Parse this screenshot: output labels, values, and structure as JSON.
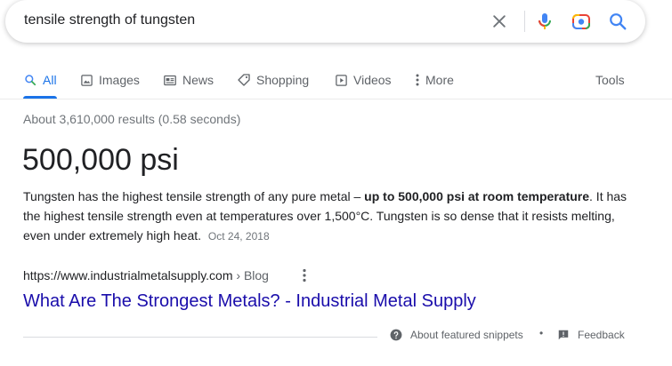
{
  "search": {
    "query": "tensile strength of tungsten"
  },
  "tabs": [
    {
      "label": "All",
      "icon": "search-icon",
      "active": true
    },
    {
      "label": "Images",
      "icon": "image-icon"
    },
    {
      "label": "News",
      "icon": "news-icon"
    },
    {
      "label": "Shopping",
      "icon": "tag-icon"
    },
    {
      "label": "Videos",
      "icon": "play-icon"
    },
    {
      "label": "More",
      "icon": "more-vert-icon"
    }
  ],
  "tools_label": "Tools",
  "results_count": "About 3,610,000 results (0.58 seconds)",
  "featured": {
    "answer": "500,000 psi",
    "snippet_before": "Tungsten has the highest tensile strength of any pure metal – ",
    "snippet_bold": "up to 500,000 psi at room temperature",
    "snippet_after": ". It has the highest tensile strength even at temperatures over 1,500°C. Tungsten is so dense that it resists melting, even under extremely high heat.",
    "date": "Oct 24, 2018",
    "cite_url": "https://www.industrialmetalsupply.com",
    "cite_crumb": " › Blog",
    "title": "What Are The Strongest Metals? - Industrial Metal Supply"
  },
  "footer": {
    "about_label": "About featured snippets",
    "separator": "•",
    "feedback_label": "Feedback"
  },
  "colors": {
    "accent": "#1a73e8",
    "link": "#1a0dab",
    "secondary_text": "#70757a"
  }
}
